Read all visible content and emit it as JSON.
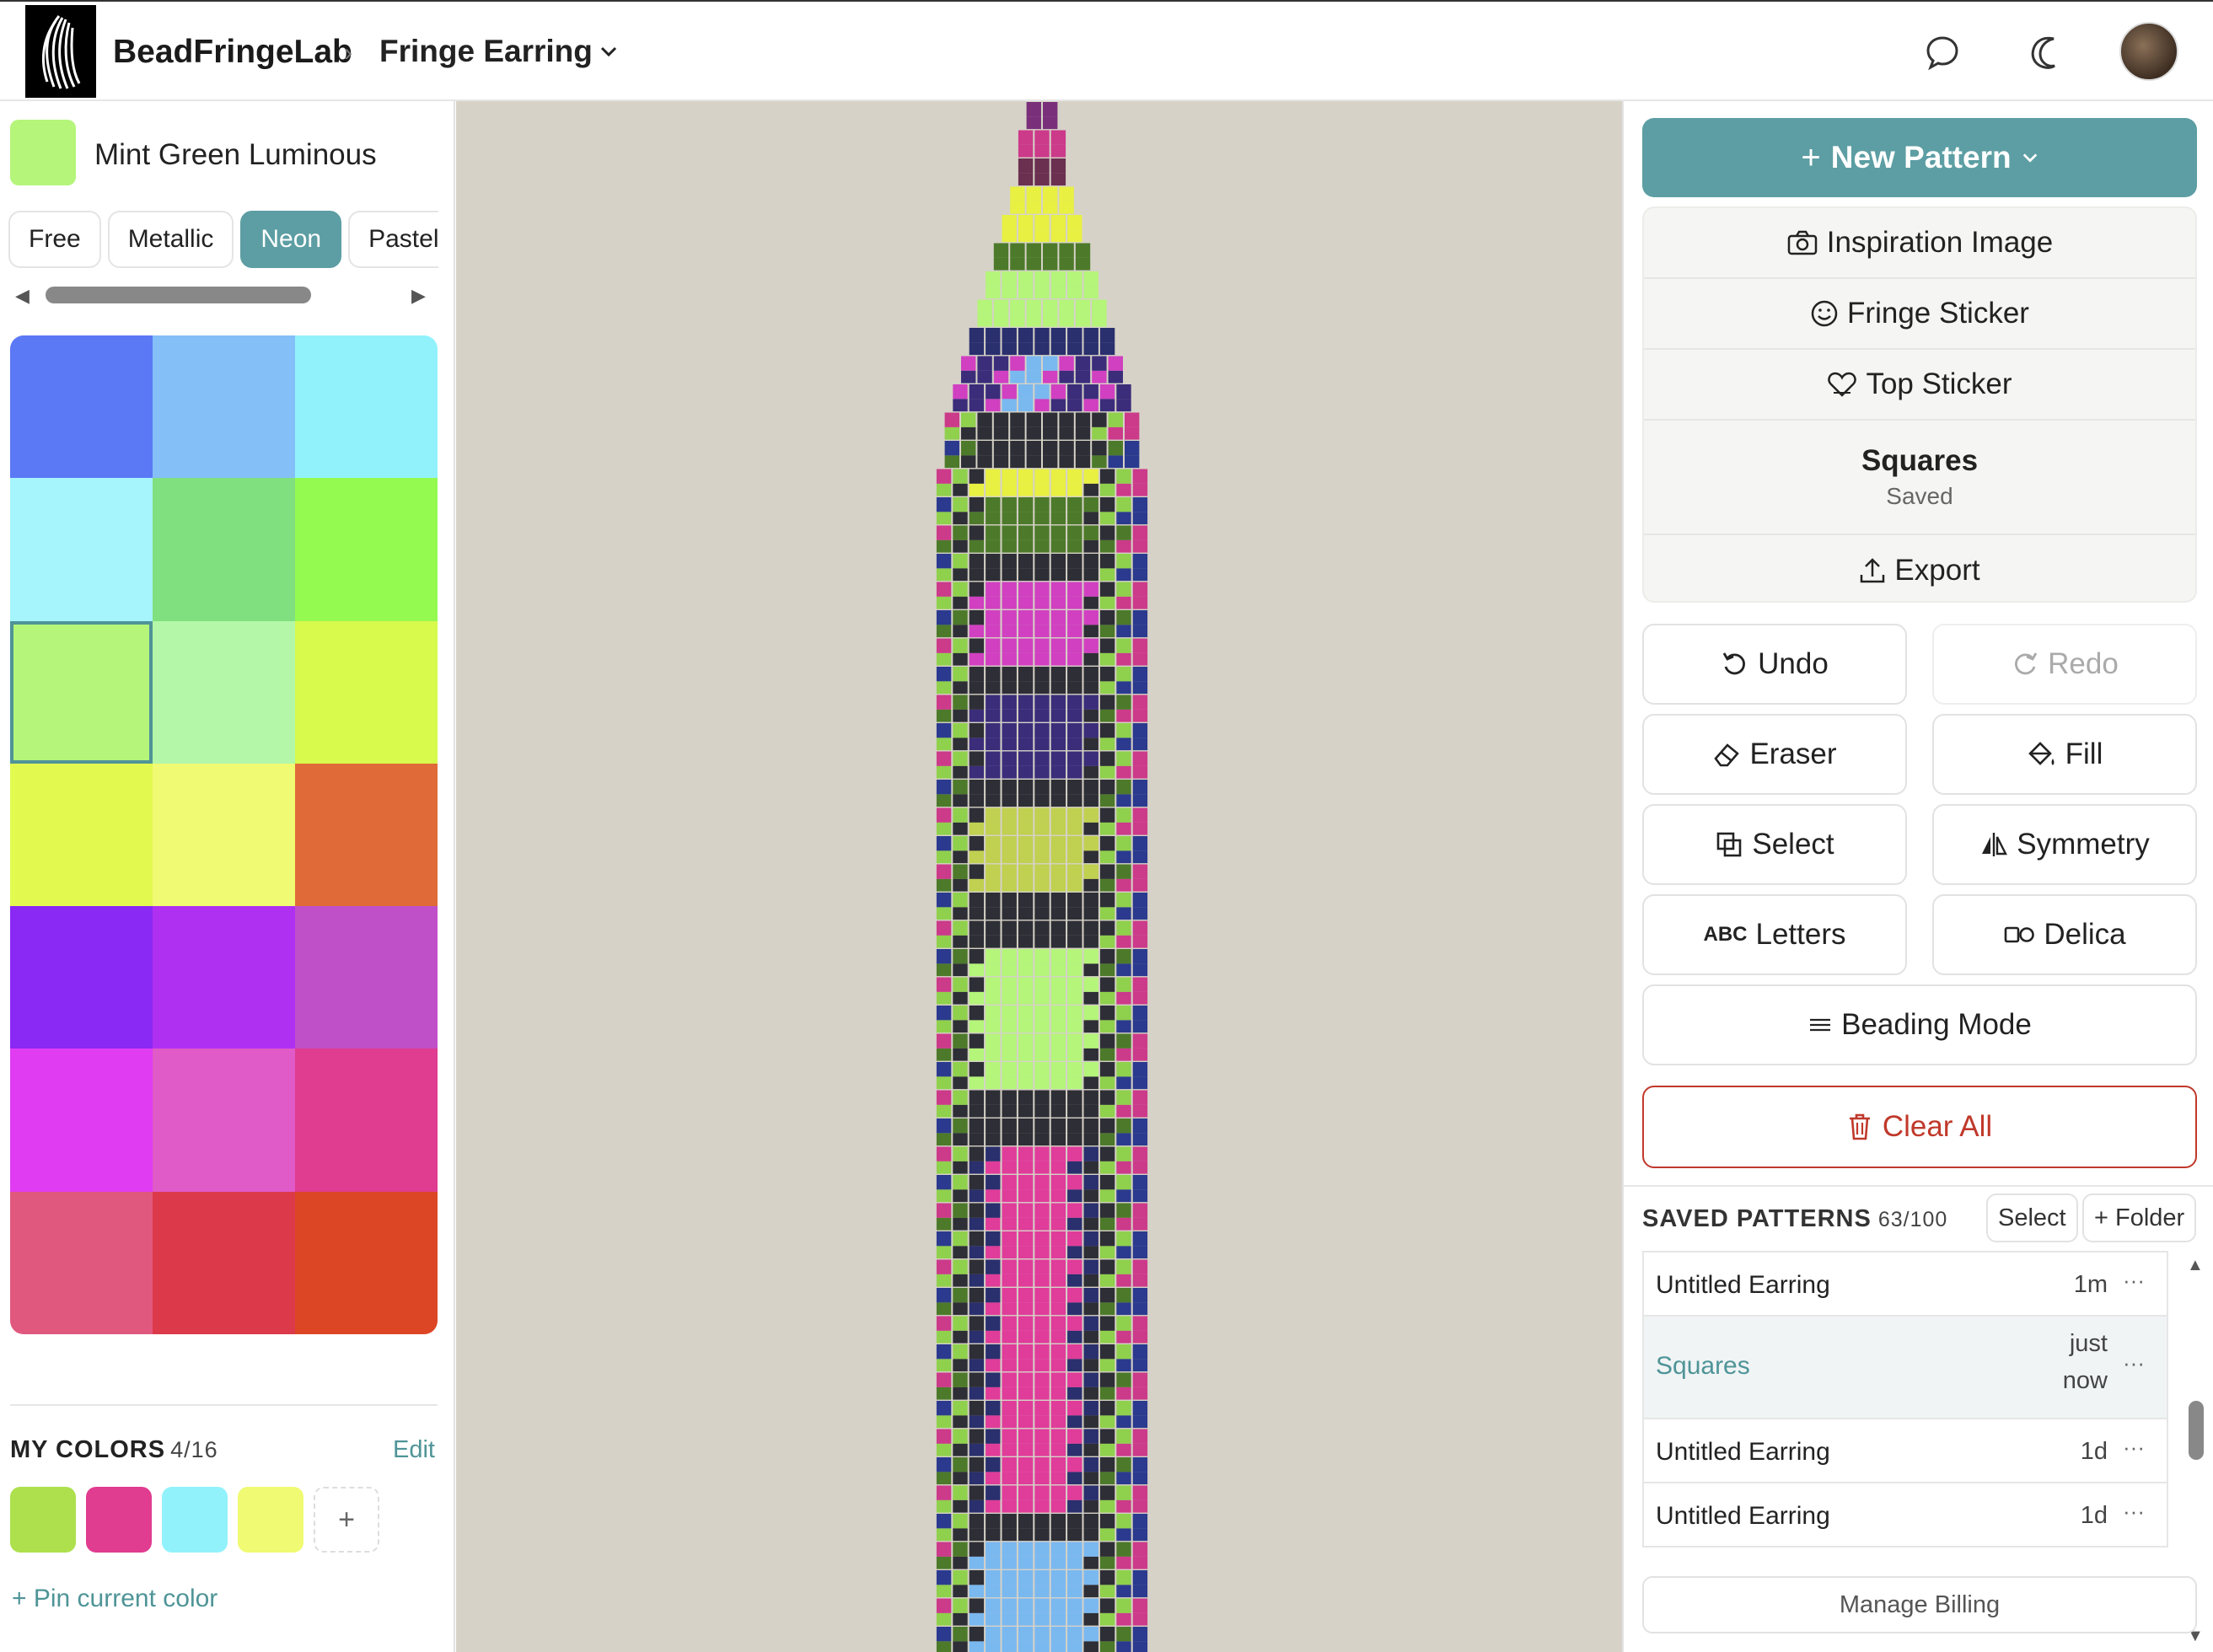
{
  "app": {
    "name": "BeadFringeLab",
    "breadcrumb_sep": "›",
    "current_pattern": "Fringe Earring"
  },
  "header": {
    "icons": [
      "chat-icon",
      "moon-icon",
      "avatar"
    ]
  },
  "left": {
    "current_color": {
      "name": "Mint Green Luminous",
      "hex": "#b4f57a"
    },
    "tabs": [
      {
        "label": "Free",
        "active": false
      },
      {
        "label": "Metallic",
        "active": false
      },
      {
        "label": "Neon",
        "active": true
      },
      {
        "label": "Pastel",
        "active": false
      }
    ],
    "palette": [
      "#5b78f5",
      "#84bff8",
      "#92f2fc",
      "#a6f4fc",
      "#80e080",
      "#94fa50",
      "#b4f57a",
      "#b4f7a8",
      "#d7fa4c",
      "#e2fa50",
      "#f0fa72",
      "#e06b38",
      "#8a28f4",
      "#b030f2",
      "#c050c8",
      "#e03cf2",
      "#e05ac8",
      "#e03c90",
      "#e0587e",
      "#dc3a4a",
      "#dc4624"
    ],
    "selected_palette_index": 6,
    "my_colors": {
      "title": "MY COLORS",
      "count": "4/16",
      "edit_label": "Edit",
      "colors": [
        "#ade04c",
        "#e03c90",
        "#92f2fc",
        "#f0fa72"
      ],
      "add_label": "+"
    },
    "pin_label": "+  Pin current color"
  },
  "right": {
    "new_pattern_label": "New Pattern",
    "menu": [
      {
        "label": "Inspiration Image",
        "icon": "camera-icon"
      },
      {
        "label": "Fringe Sticker",
        "icon": "smiley-icon"
      },
      {
        "label": "Top Sticker",
        "icon": "heart-icon"
      }
    ],
    "current": {
      "title": "Squares",
      "status": "Saved"
    },
    "export_label": "Export",
    "tools": [
      {
        "label": "Undo",
        "icon": "undo-icon",
        "enabled": true
      },
      {
        "label": "Redo",
        "icon": "redo-icon",
        "enabled": false
      },
      {
        "label": "Eraser",
        "icon": "eraser-icon",
        "enabled": true
      },
      {
        "label": "Fill",
        "icon": "paint-bucket-icon",
        "enabled": true
      },
      {
        "label": "Select",
        "icon": "select-icon",
        "enabled": true
      },
      {
        "label": "Symmetry",
        "icon": "symmetry-icon",
        "enabled": true
      },
      {
        "label": "Letters",
        "icon": "abc-icon",
        "icon_text": "ABC",
        "enabled": true
      },
      {
        "label": "Delica",
        "icon": "delica-icon",
        "enabled": true
      }
    ],
    "beading_mode_label": "Beading Mode",
    "clear_all_label": "Clear All",
    "saved": {
      "title": "SAVED PATTERNS",
      "count": "63/100",
      "select_label": "Select",
      "folder_label": "+ Folder",
      "items": [
        {
          "name": "Untitled Earring",
          "time": "1m",
          "active": false
        },
        {
          "name": "Squares",
          "time": "just now",
          "active": true
        },
        {
          "name": "Untitled Earring",
          "time": "1d",
          "active": false
        },
        {
          "name": "Untitled Earring",
          "time": "1d",
          "active": false
        }
      ]
    },
    "manage_billing_label": "Manage Billing"
  }
}
